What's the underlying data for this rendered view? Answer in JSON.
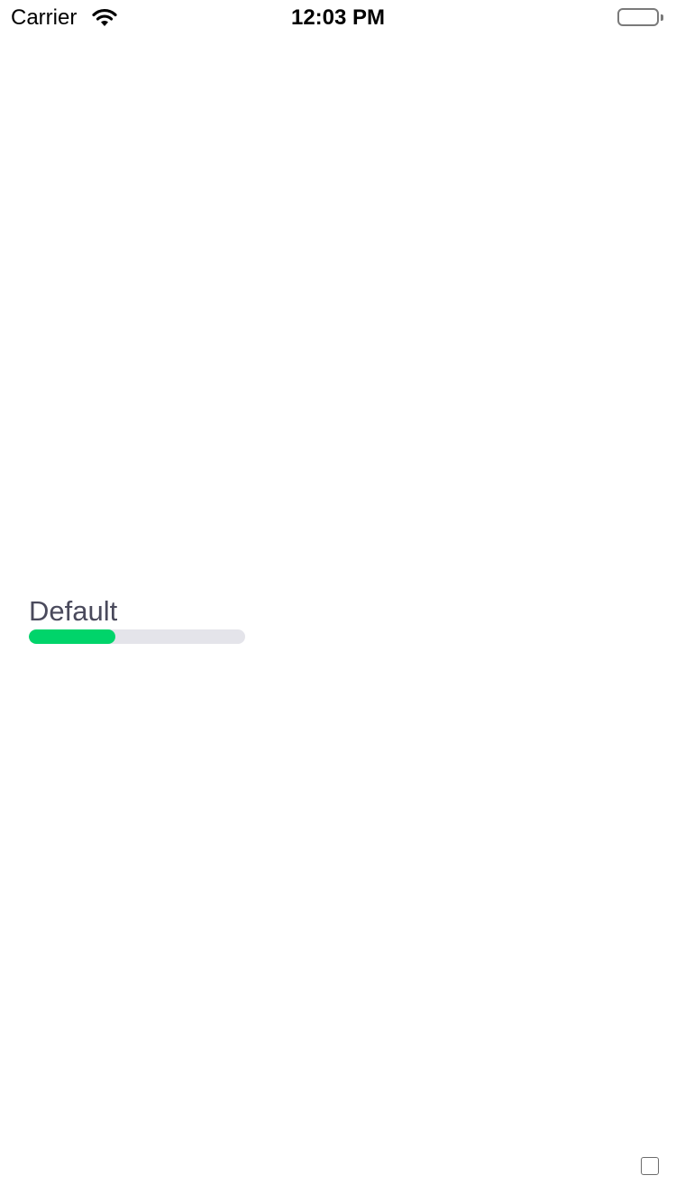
{
  "status_bar": {
    "carrier": "Carrier",
    "time": "12:03 PM",
    "icons": [
      "wifi-icon",
      "battery-icon"
    ]
  },
  "progress": {
    "label": "Default",
    "value_fraction": 0.4,
    "fill_color": "#00d46a",
    "track_color": "#e4e4ea"
  },
  "colors": {
    "background": "#ffffff",
    "label_text": "#4a4a5c"
  }
}
